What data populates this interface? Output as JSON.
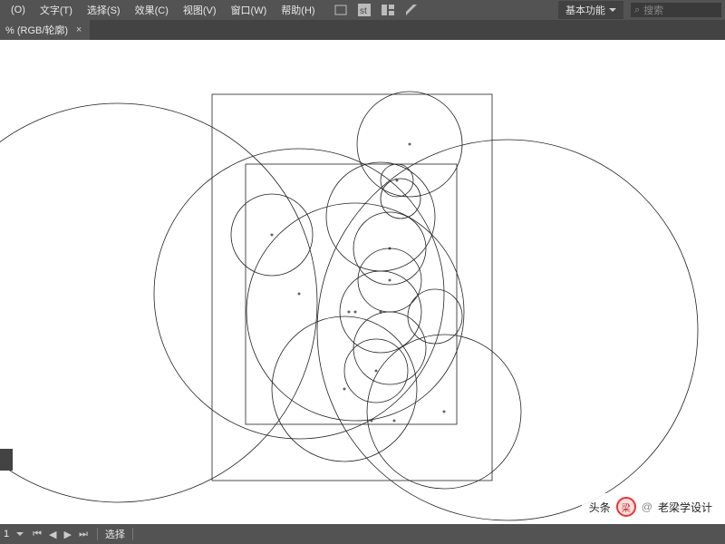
{
  "menu": {
    "object": "(O)",
    "type": "文字(T)",
    "select": "选择(S)",
    "effect": "效果(C)",
    "view": "视图(V)",
    "window": "窗口(W)",
    "help": "帮助(H)"
  },
  "workspace": {
    "label": "基本功能"
  },
  "search": {
    "placeholder": "搜索"
  },
  "document": {
    "tab_label": "% (RGB/轮廓)"
  },
  "status": {
    "page": "1",
    "tool": "选择"
  },
  "watermark": {
    "source": "头条",
    "at": "@",
    "name": "老梁学设计",
    "avatar_text": "梁"
  }
}
